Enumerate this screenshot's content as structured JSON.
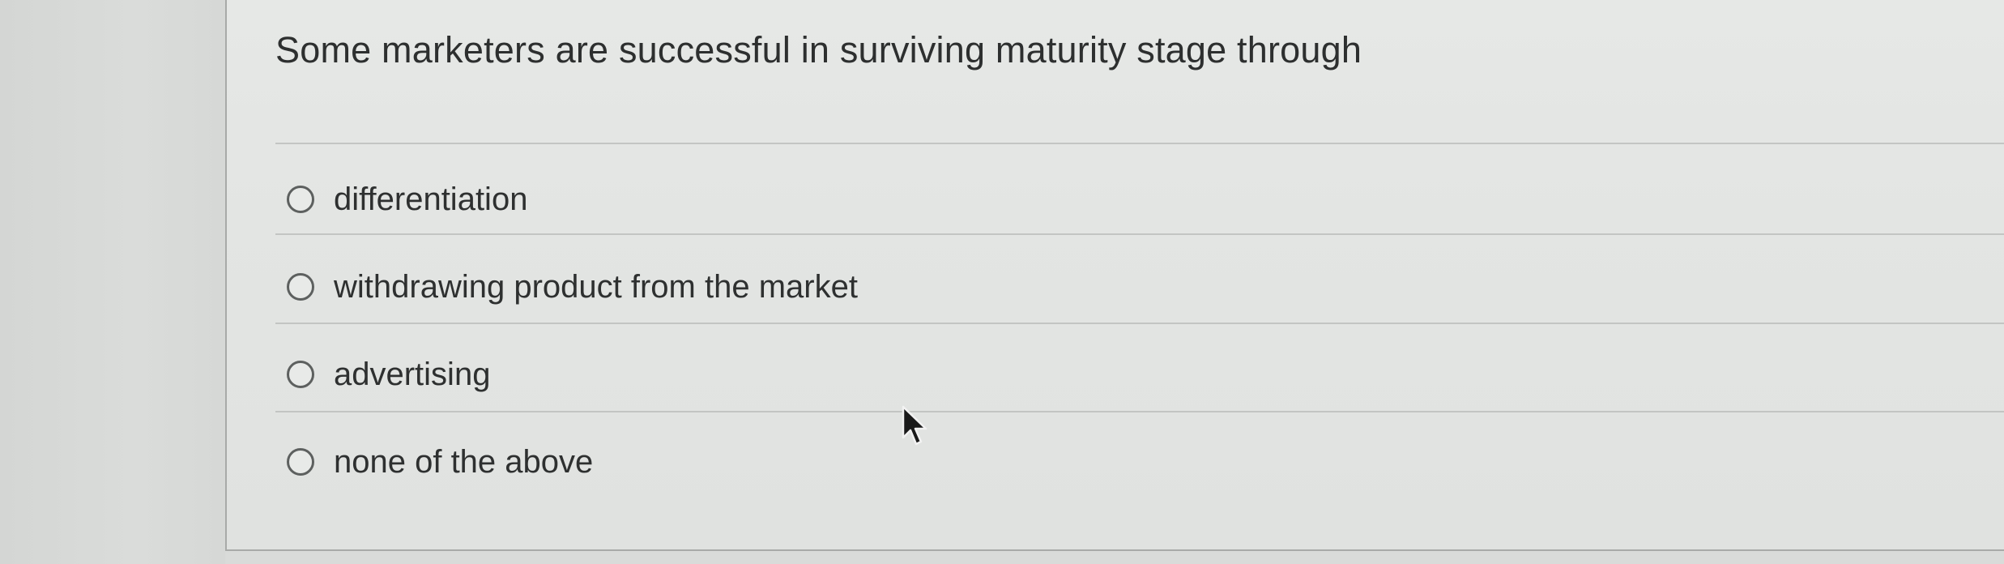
{
  "question": {
    "text": "Some marketers are successful in surviving maturity stage through"
  },
  "options": [
    {
      "label": "differentiation",
      "selected": false
    },
    {
      "label": "withdrawing product from the market",
      "selected": false
    },
    {
      "label": "advertising",
      "selected": false
    },
    {
      "label": "none of the above",
      "selected": false
    }
  ],
  "icons": {
    "radio": "radio-button-unchecked-icon",
    "cursor": "mouse-pointer-icon"
  }
}
